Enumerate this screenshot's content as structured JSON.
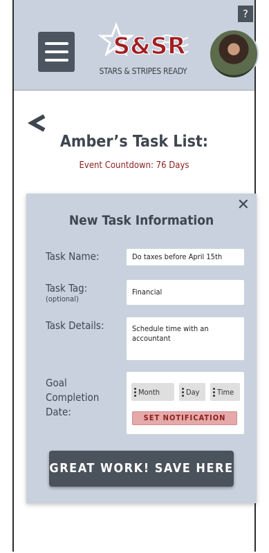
{
  "header": {
    "help_label": "?",
    "logo_text": "S&SR",
    "logo_tagline": "STARS & STRIPES READY"
  },
  "page": {
    "title": "Amber’s Task List:",
    "countdown": "Event Countdown: 76 Days"
  },
  "task_form": {
    "close_label": "✕",
    "title": "New Task Information",
    "name_label": "Task Name:",
    "name_value": "Do taxes before April 15th",
    "tag_label": "Task Tag:",
    "tag_optional": "(optional)",
    "tag_value": "Financial",
    "details_label": "Task Details:",
    "details_value": "Schedule time with an accountant",
    "date_label": "Goal Completion Date:",
    "date_month": "Month",
    "date_day": "Day",
    "date_time": "Time",
    "notification_label": "SET NOTIFICATION",
    "save_label": "GREAT WORK! SAVE HERE"
  },
  "colors": {
    "header_bg": "#c8d1dd",
    "dark_button": "#4a525b",
    "accent_red": "#8b1e1e",
    "notification_pink": "#e5a9a9"
  }
}
